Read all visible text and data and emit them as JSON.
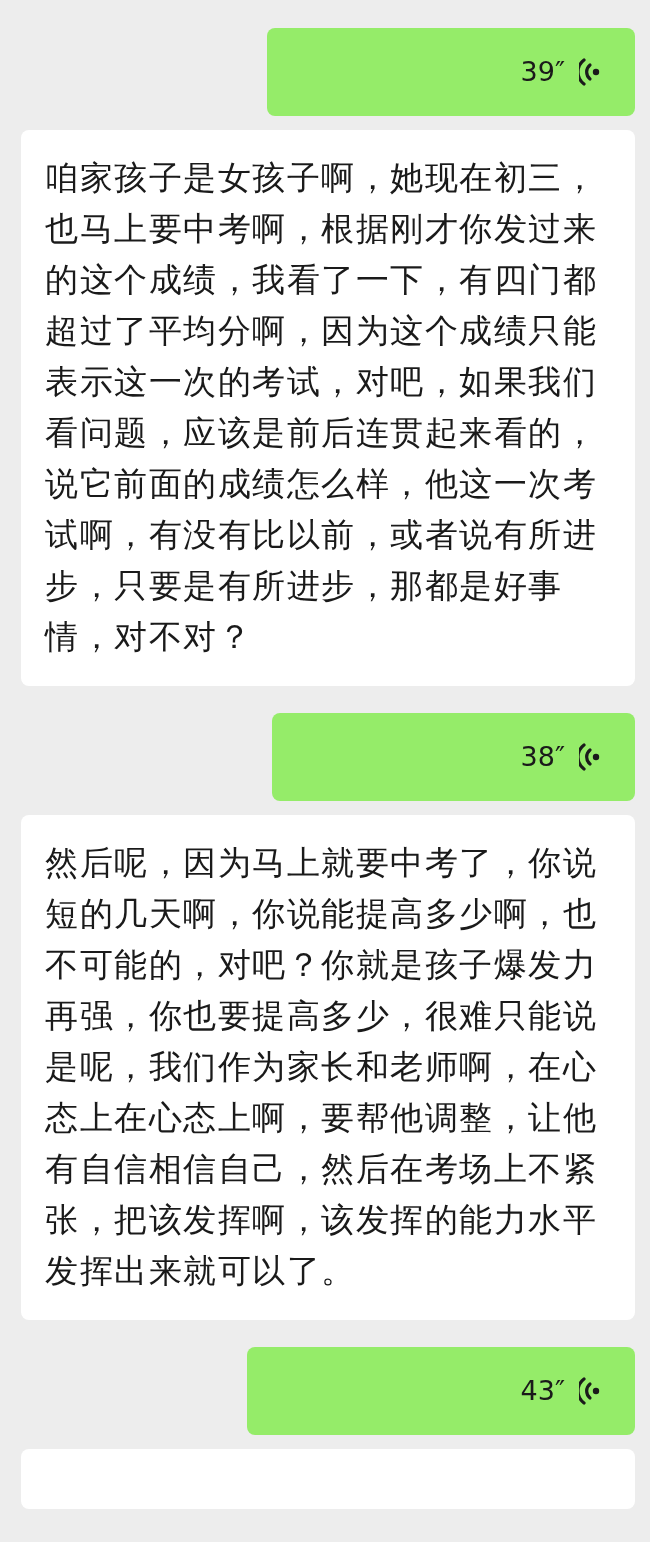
{
  "messages": [
    {
      "kind": "voice",
      "duration": "39″"
    },
    {
      "kind": "transcript",
      "text": "咱家孩子是女孩子啊，她现在初三，也马上要中考啊，根据刚才你发过来的这个成绩，我看了一下，有四门都超过了平均分啊，因为这个成绩只能表示这一次的考试，对吧，如果我们看问题，应该是前后连贯起来看的，说它前面的成绩怎么样，他这一次考试啊，有没有比以前，或者说有所进步，只要是有所进步，那都是好事情，对不对？"
    },
    {
      "kind": "voice",
      "duration": "38″"
    },
    {
      "kind": "transcript",
      "text": "然后呢，因为马上就要中考了，你说短的几天啊，你说能提高多少啊，也不可能的，对吧？你就是孩子爆发力再强，你也要提高多少，很难只能说是呢，我们作为家长和老师啊，在心态上在心态上啊，要帮他调整，让他有自信相信自己，然后在考场上不紧张，把该发挥啊，该发挥的能力水平发挥出来就可以了。"
    },
    {
      "kind": "voice",
      "duration": "43″"
    },
    {
      "kind": "transcript"
    }
  ]
}
